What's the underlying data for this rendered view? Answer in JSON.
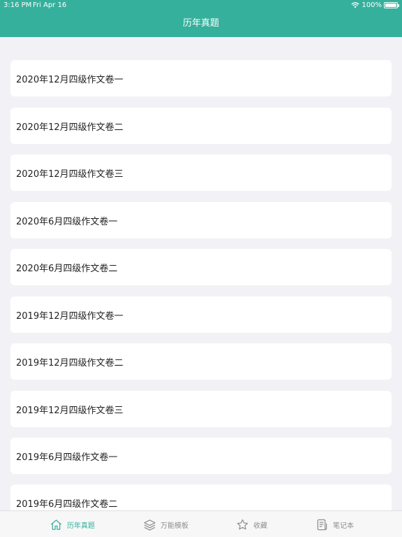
{
  "status_bar": {
    "time": "3:16 PM",
    "date": "Fri Apr 16",
    "battery": "100%",
    "battery_level": 1.0,
    "wifi_icon": "wifi-icon"
  },
  "header": {
    "title": "历年真题"
  },
  "items": [
    "2020年12月四级作文卷一",
    "2020年12月四级作文卷二",
    "2020年12月四级作文卷三",
    "2020年6月四级作文卷一",
    "2020年6月四级作文卷二",
    "2019年12月四级作文卷一",
    "2019年12月四级作文卷二",
    "2019年12月四级作文卷三",
    "2019年6月四级作文卷一",
    "2019年6月四级作文卷二"
  ],
  "tabs": [
    {
      "label": "历年真题",
      "icon": "home-icon",
      "active": true
    },
    {
      "label": "万能模板",
      "icon": "layers-icon",
      "active": false
    },
    {
      "label": "收藏",
      "icon": "star-icon",
      "active": false
    },
    {
      "label": "笔记本",
      "icon": "notebook-icon",
      "active": false
    }
  ],
  "colors": {
    "accent": "#35b09c",
    "background": "#f2f2f6",
    "card": "#ffffff",
    "tab_inactive": "#8e8e8e"
  }
}
